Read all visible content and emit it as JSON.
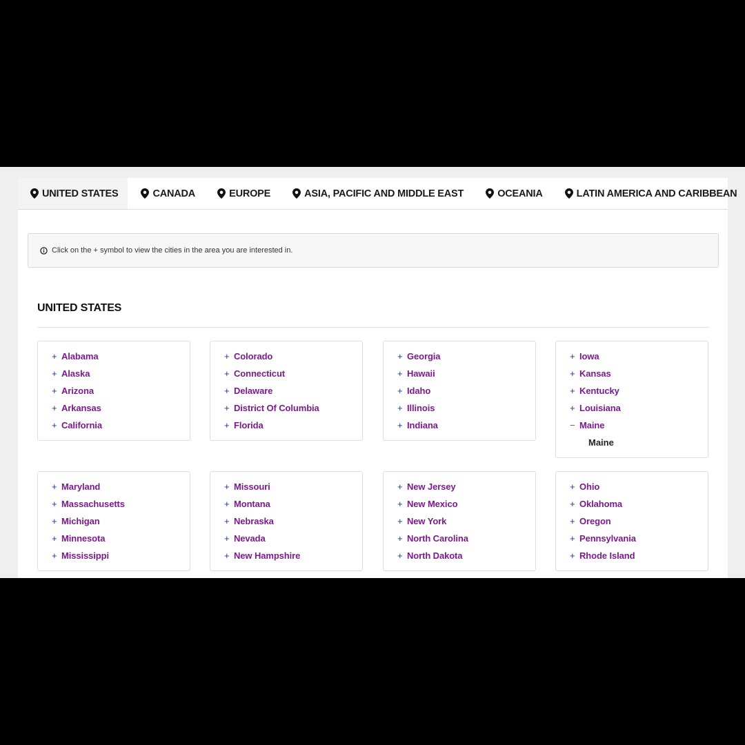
{
  "tabs": [
    {
      "label": "UNITED STATES",
      "active": true
    },
    {
      "label": "CANADA",
      "active": false
    },
    {
      "label": "EUROPE",
      "active": false
    },
    {
      "label": "ASIA, PACIFIC AND MIDDLE EAST",
      "active": false
    },
    {
      "label": "OCEANIA",
      "active": false
    },
    {
      "label": "LATIN AMERICA AND CARIBBEAN",
      "active": false
    }
  ],
  "notice": {
    "icon": "info-icon",
    "text": "Click on the + symbol to view the cities in the area you are interested in."
  },
  "section": {
    "title": "UNITED STATES"
  },
  "expand_symbol": "+",
  "collapse_symbol": "−",
  "cards": [
    {
      "items": [
        "Alabama",
        "Alaska",
        "Arizona",
        "Arkansas",
        "California"
      ]
    },
    {
      "items": [
        "Colorado",
        "Connecticut",
        "Delaware",
        "District Of Columbia",
        "Florida"
      ]
    },
    {
      "items": [
        "Georgia",
        "Hawaii",
        "Idaho",
        "Illinois",
        "Indiana"
      ]
    },
    {
      "items": [
        "Iowa",
        "Kansas",
        "Kentucky",
        "Louisiana",
        "Maine"
      ],
      "expanded": "Maine",
      "cities": [
        "Maine"
      ]
    },
    {
      "items": [
        "Maryland",
        "Massachusetts",
        "Michigan",
        "Minnesota",
        "Mississippi"
      ]
    },
    {
      "items": [
        "Missouri",
        "Montana",
        "Nebraska",
        "Nevada",
        "New Hampshire"
      ]
    },
    {
      "items": [
        "New Jersey",
        "New Mexico",
        "New York",
        "North Carolina",
        "North Dakota"
      ]
    },
    {
      "items": [
        "Ohio",
        "Oklahoma",
        "Oregon",
        "Pennsylvania",
        "Rhode Island"
      ]
    }
  ],
  "colors": {
    "link": "#7b1a8c",
    "plus": "#1a3a8c",
    "letterbox": "#000000",
    "tab_active_bg": "#f3f3f3"
  }
}
